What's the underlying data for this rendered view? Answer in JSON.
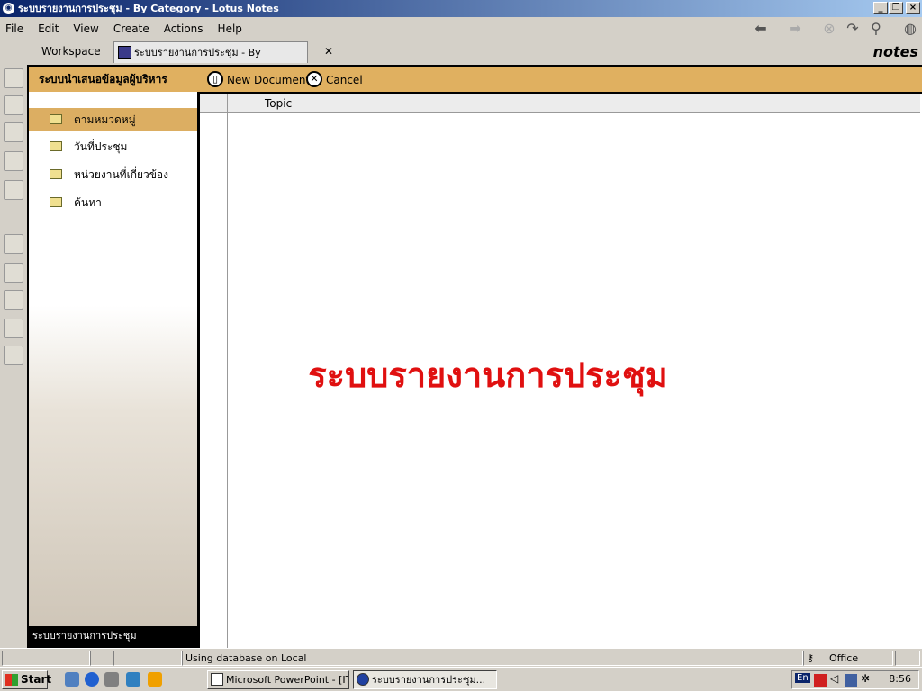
{
  "window": {
    "title": "ระบบรายงานการประชุม - By Category - Lotus Notes"
  },
  "menu": [
    "File",
    "Edit",
    "View",
    "Create",
    "Actions",
    "Help"
  ],
  "tabs": {
    "workspace": "Workspace",
    "active": "ระบบรายงานการประชุม - By Category"
  },
  "brand": "notes",
  "nav": {
    "header": "ระบบนำเสนอข้อมูลผู้บริหาร",
    "items": [
      "ตามหมวดหมู่",
      "วันที่ประชุม",
      "หน่วยงานที่เกี่ยวข้อง",
      "ค้นหา"
    ],
    "selected_index": 0,
    "footer": "ระบบรายงานการประชุม"
  },
  "actions": {
    "new_document": "New Document",
    "cancel": "Cancel"
  },
  "view": {
    "column_topic": "Topic",
    "banner": "ระบบรายงานการประชุม"
  },
  "status": {
    "message": "Using database on Local",
    "location": "Office"
  },
  "taskbar": {
    "start": "Start",
    "tasks": [
      "Microsoft PowerPoint - [IT...",
      "ระบบรายงานการประชุม..."
    ],
    "tray_lang": "En",
    "clock": "8:56"
  },
  "colors": {
    "accent": "#e0b060",
    "banner": "#e01010",
    "title_bar": "#0a246a"
  }
}
